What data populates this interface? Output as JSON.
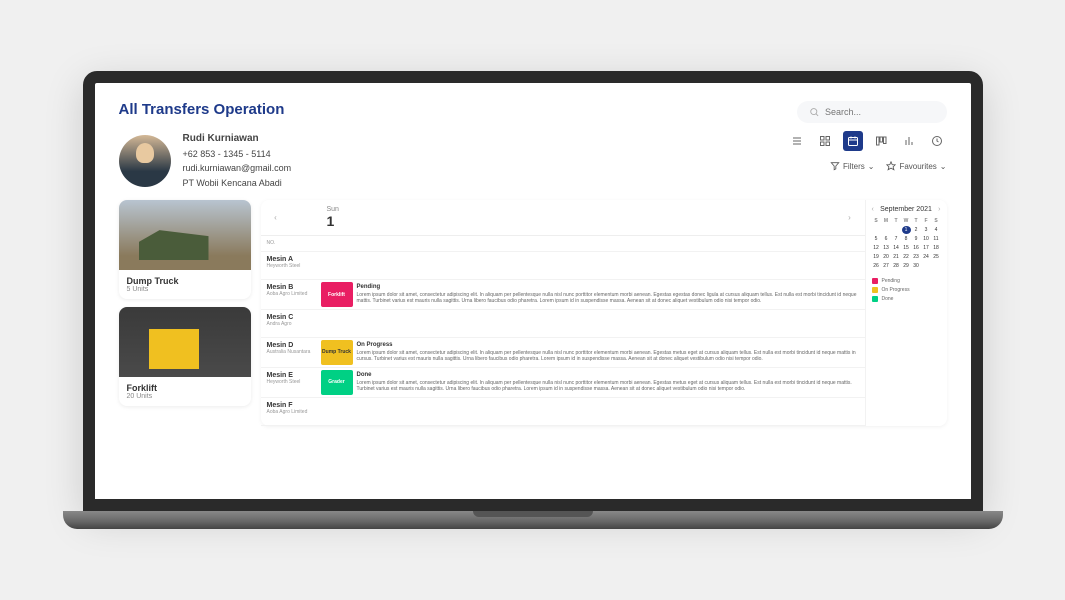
{
  "page_title": "All Transfers Operation",
  "search": {
    "placeholder": "Search..."
  },
  "profile": {
    "name": "Rudi Kurniawan",
    "phone": "+62 853 - 1345 - 5114",
    "email": "rudi.kurniawan@gmail.com",
    "company": "PT Wobii Kencana Abadi"
  },
  "toolbar": {
    "filters_label": "Filters",
    "favourites_label": "Favourites"
  },
  "cards": [
    {
      "title": "Dump Truck",
      "subtitle": "5 Units"
    },
    {
      "title": "Forklift",
      "subtitle": "20 Units"
    }
  ],
  "schedule": {
    "day_label": "Sun",
    "day_num": "1",
    "no_label": "NO.",
    "machines": [
      {
        "name": "Mesin A",
        "sub": "Heyworth Steel"
      },
      {
        "name": "Mesin B",
        "sub": "Aoba Agro Limited"
      },
      {
        "name": "Mesin C",
        "sub": "Andra Agro"
      },
      {
        "name": "Mesin D",
        "sub": "Australia Nusantara"
      },
      {
        "name": "Mesin E",
        "sub": "Heyworth Steel"
      },
      {
        "name": "Mesin F",
        "sub": "Aoba Agro Limited"
      }
    ],
    "events": {
      "1": {
        "tag": "Forklift",
        "color": "pink",
        "title": "Pending",
        "desc": "Lorem ipsum dolor sit amet, consectetur adipiscing elit. In aliquam per pellentesque nulla nisl nunc porttitor elementum morbi aenean. Egestas egestas donec ligula at cursus aliquam tellus. Est nulla est morbi tincidunt id neque mattis. Turbinet varius est mauris nulla sagittis. Urna libero faucibus odio pharetra. Lorem ipsum id in suspendisse massa. Aenean sit at donec aliquet vestibulum odio nisi tempor odio."
      },
      "3": {
        "tag": "Dump Truck",
        "color": "yellow",
        "title": "On Progress",
        "desc": "Lorem ipsum dolor sit amet, consectetur adipiscing elit. In aliquam per pellentesque nulla nisl nunc porttitor elementum morbi aenean. Egestas metus eget at cursus aliquam tellus. Est nulla est morbi tincidunt id neque mattis in cursus. Turbinet varius est mauris nulla sagittis. Urna libero faucibus odio pharetra. Lorem ipsum id in suspendisse massa. Aenean sit at donec aliquet vestibulum odio nisi tempor odio."
      },
      "4": {
        "tag": "Grader",
        "color": "green",
        "title": "Done",
        "desc": "Lorem ipsum dolor sit amet, consectetur adipiscing elit. In aliquam per pellentesque nulla nisl nunc porttitor elementum morbi aenean. Egestas metus eget at cursus aliquam tellus. Est nulla est morbi tincidunt id neque mattis. Turbinet varius est mauris nulla sagittis. Urna libero faucibus odio pharetra. Lorem ipsum id in suspendisse massa. Aenean sit at donec aliquet vestibulum odio nisi tempor odio."
      }
    }
  },
  "calendar": {
    "month_label": "September 2021",
    "day_headers": [
      "S",
      "M",
      "T",
      "W",
      "T",
      "F",
      "S"
    ],
    "weeks": [
      [
        "",
        "",
        "",
        "1",
        "2",
        "3",
        "4"
      ],
      [
        "5",
        "6",
        "7",
        "8",
        "9",
        "10",
        "11"
      ],
      [
        "12",
        "13",
        "14",
        "15",
        "16",
        "17",
        "18"
      ],
      [
        "19",
        "20",
        "21",
        "22",
        "23",
        "24",
        "25"
      ],
      [
        "26",
        "27",
        "28",
        "29",
        "30",
        "",
        ""
      ]
    ],
    "selected": "1"
  },
  "legend": [
    {
      "label": "Pending",
      "color": "#e91e63"
    },
    {
      "label": "On Progress",
      "color": "#f0c020"
    },
    {
      "label": "Done",
      "color": "#00d084"
    }
  ]
}
